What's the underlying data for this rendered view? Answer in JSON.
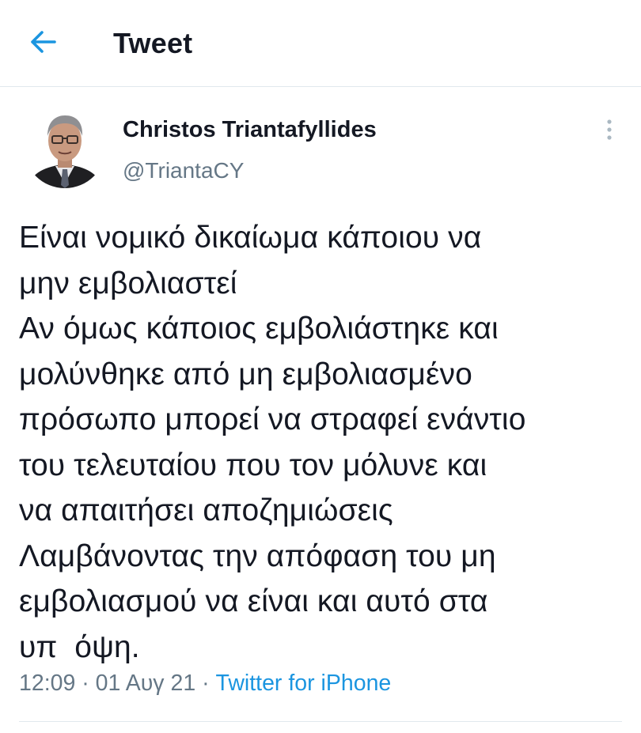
{
  "header": {
    "back_icon": "arrow-left-icon",
    "title": "Tweet"
  },
  "author": {
    "name": "Christos Triantafyllides",
    "handle": "@TriantaCY",
    "avatar_icon": "profile-photo",
    "more_icon": "more-vertical-icon"
  },
  "tweet": {
    "lines": [
      "Είναι νομικό δικαίωμα κάποιου να",
      "μην εμβολιαστεί",
      "Αν όμως κάποιος εμβολιάστηκε και",
      "μολύνθηκε από μη εμβολιασμένο",
      "πρόσωπο μπορεί να στραφεί ενάντιο",
      "του τελευταίου που τον μόλυνε και",
      "να απαιτήσει αποζημιώσεις",
      "Λαμβάνοντας την απόφαση του μη",
      "εμβολιασμού να είναι και αυτό στα",
      "υπ  όψη."
    ],
    "time": "12:09",
    "separator": " · ",
    "date": "01 Αυγ 21",
    "source": "Twitter for iPhone"
  },
  "colors": {
    "accent": "#1b95e0",
    "text": "#141823",
    "secondary": "#657786",
    "divider": "#e1e8ed"
  }
}
